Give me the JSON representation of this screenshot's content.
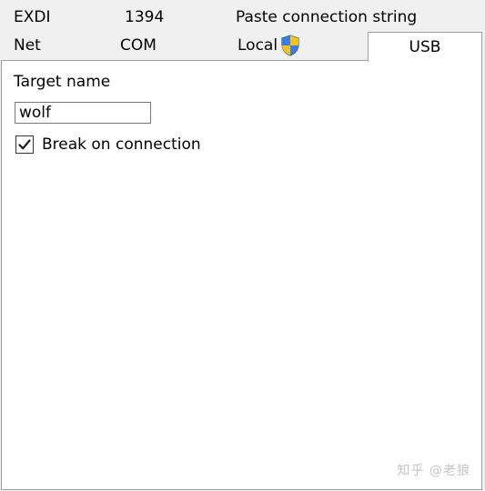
{
  "tabs": {
    "row1": [
      {
        "id": "exdi",
        "label": "EXDI"
      },
      {
        "id": "1394",
        "label": "1394"
      },
      {
        "id": "paste",
        "label": "Paste connection string"
      }
    ],
    "row2": [
      {
        "id": "net",
        "label": "Net"
      },
      {
        "id": "com",
        "label": "COM"
      },
      {
        "id": "local",
        "label": "Local",
        "icon": "uac-shield-icon"
      },
      {
        "id": "usb",
        "label": "USB",
        "selected": true
      }
    ]
  },
  "panel": {
    "target_label": "Target name",
    "target_value": "wolf",
    "break_label": "Break on connection",
    "break_checked": true
  },
  "watermark": "知乎 @老狼",
  "colors": {
    "window_bg": "#f0f0f0",
    "panel_bg": "#ffffff",
    "checkbox_tick": "#1a1a1a",
    "shield_blue": "#2f6fd0",
    "shield_yellow": "#f4c21b"
  }
}
